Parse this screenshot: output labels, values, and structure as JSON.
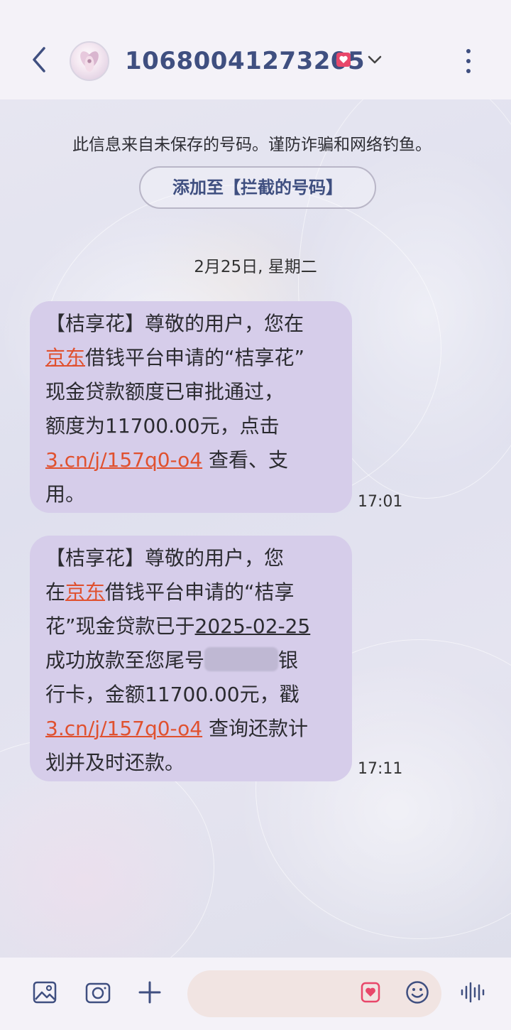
{
  "header": {
    "contact_number": "10680041273205"
  },
  "notice": {
    "text": "此信息来自未保存的号码。谨防诈骗和网络钓鱼。",
    "block_button_label": "添加至【拦截的号码】"
  },
  "date_divider": "2月25日, 星期二",
  "messages": [
    {
      "parts": {
        "p1": "【桔享花】尊敬的用户，您在",
        "link1": "京东",
        "p2": "借钱平台申请的“桔享花”",
        "p3": "现金贷款额度已审批通过，",
        "p4": "额度为11700.00元，点击",
        "link2": "3.cn/j/157q0-o4",
        "p5": " 查看、支",
        "p6": "用。"
      },
      "time": "17:01"
    },
    {
      "parts": {
        "p1": "【桔享花】尊敬的用户，您",
        "p2": "在",
        "link1": "京东",
        "p3": "借钱平台申请的“桔享",
        "p4": "花”现金贷款已于",
        "date": "2025-02-25",
        "p5": "成功放款至您尾号",
        "p6": "银",
        "p7": "行卡，金额11700.00元，戳",
        "link2": "3.cn/j/157q0-o4",
        "p8": " 查询还款计",
        "p9": "划并及时还款。"
      },
      "time": "17:11"
    }
  ],
  "colors": {
    "accent": "#3f4f80",
    "bubble": "#d6cdea",
    "link": "#e0512f",
    "spam_tag": "#e8476a"
  },
  "icons": [
    "back-icon",
    "avatar",
    "spam-tag-icon",
    "chevron-down-icon",
    "more-icon",
    "gallery-icon",
    "camera-icon",
    "plus-icon",
    "emoji-pink-icon",
    "smiley-icon",
    "voice-icon"
  ]
}
